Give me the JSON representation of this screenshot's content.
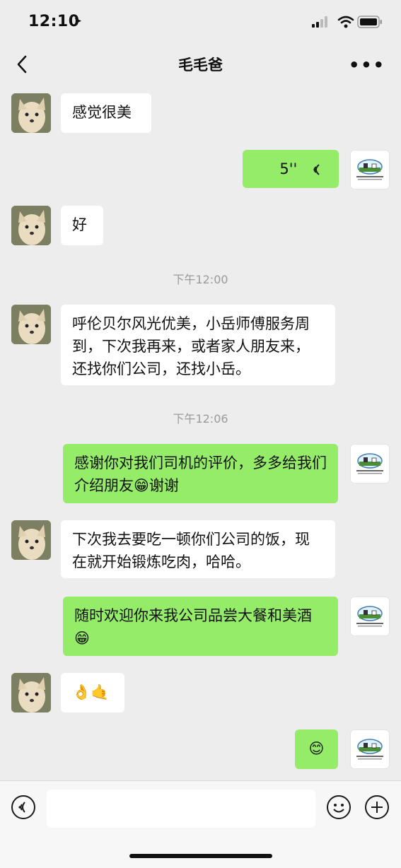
{
  "status_bar": {
    "time": "12:10"
  },
  "header": {
    "title": "毛毛爸"
  },
  "messages": [
    {
      "text": "感觉很美"
    },
    {
      "text": "5''"
    },
    {
      "text": "好"
    },
    {
      "text": "呼伦贝尔风光优美，小岳师傅服务周到，下次我再来，或者家人朋友来，还找你们公司，还找小岳。"
    },
    {
      "text": "感谢你对我们司机的评价，多多给我们介绍朋友😁谢谢"
    },
    {
      "text": "下次我去要吃一顿你们公司的饭，现在就开始锻炼吃肉，哈哈。"
    },
    {
      "text": "随时欢迎你来我公司品尝大餐和美酒😁"
    },
    {
      "text": "👌🤙"
    },
    {
      "text": "😊"
    }
  ],
  "timestamps": [
    "下午12:00",
    "下午12:06"
  ],
  "icons": {
    "back": "chevron-left-icon",
    "more": "more-icon",
    "voice": "voice-icon",
    "emoji": "emoji-icon",
    "add": "add-icon",
    "voice_wave": "voice-wave-icon"
  },
  "colors": {
    "background": "#ededed",
    "right_bubble": "#95ec69",
    "left_bubble": "#ffffff"
  }
}
